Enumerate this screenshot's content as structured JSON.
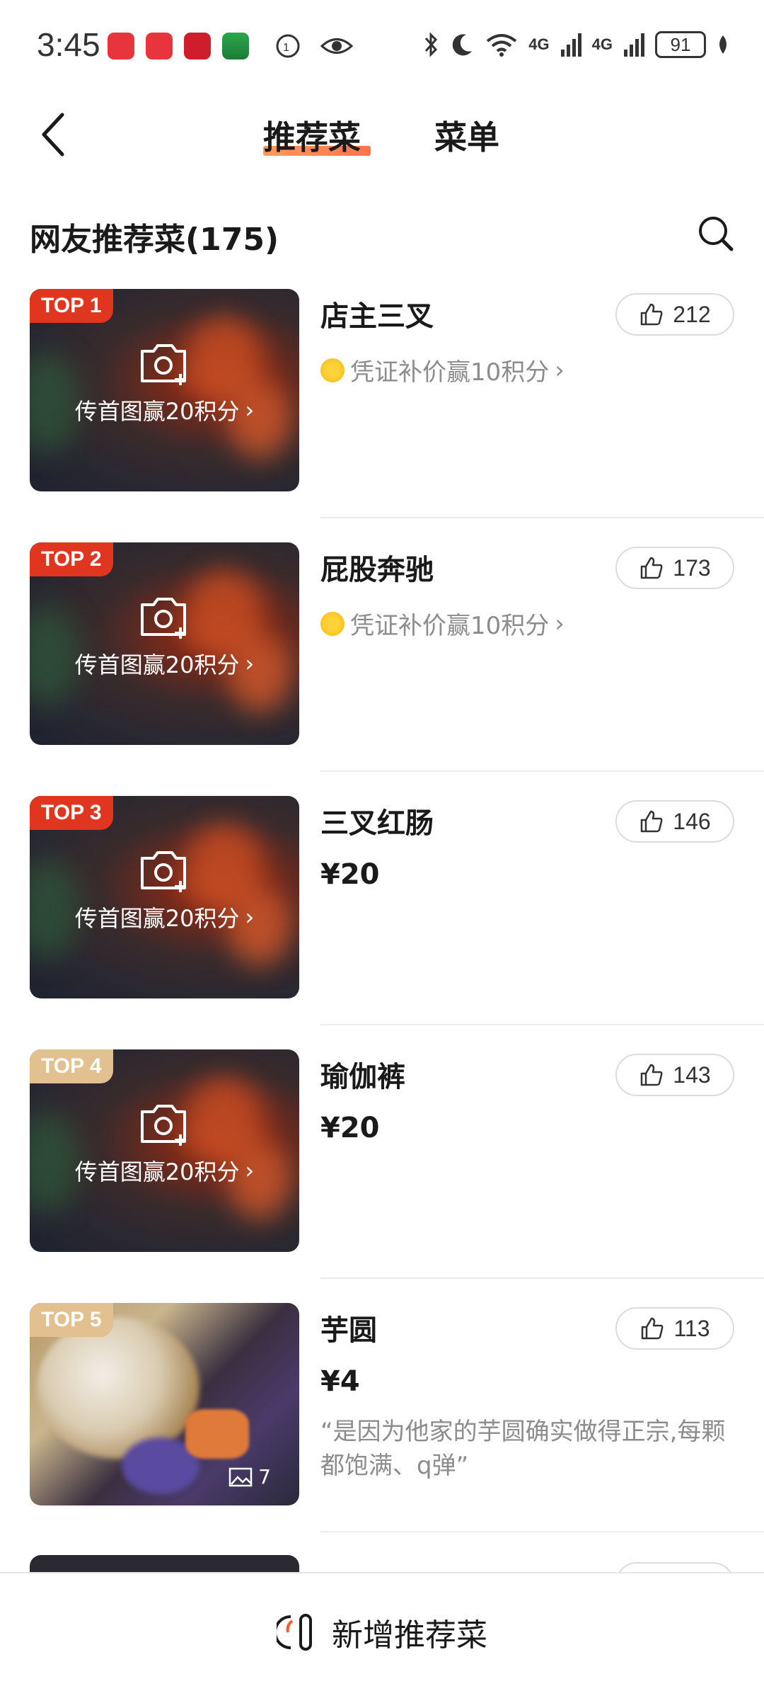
{
  "status_bar": {
    "time": "3:45",
    "signal1": "4G",
    "signal2": "4G",
    "battery": "91"
  },
  "header": {
    "tab_recommend": "推荐菜",
    "tab_menu": "菜单"
  },
  "section": {
    "title": "网友推荐菜(175)"
  },
  "dishes": [
    {
      "rank": "TOP 1",
      "name": "店主三叉",
      "likes": "212",
      "credit": "凭证补价赢10积分",
      "upload": "传首图赢20积分"
    },
    {
      "rank": "TOP 2",
      "name": "屁股奔驰",
      "likes": "173",
      "credit": "凭证补价赢10积分",
      "upload": "传首图赢20积分"
    },
    {
      "rank": "TOP 3",
      "name": "三叉红肠",
      "likes": "146",
      "price": "¥20",
      "upload": "传首图赢20积分"
    },
    {
      "rank": "TOP 4",
      "name": "瑜伽裤",
      "likes": "143",
      "price": "¥20",
      "upload": "传首图赢20积分"
    },
    {
      "rank": "TOP 5",
      "name": "芋圆",
      "likes": "113",
      "price": "¥4",
      "quote": "“是因为他家的芋圆确实做得正宗,每颗都饱满、q弹”",
      "photo_count": "7"
    }
  ],
  "bottom": {
    "add_label": "新增推荐菜"
  },
  "colors": {
    "badge_red": "#e0351e",
    "badge_gold": "#e2c08f",
    "tab_accent": "#ff6a2a"
  }
}
